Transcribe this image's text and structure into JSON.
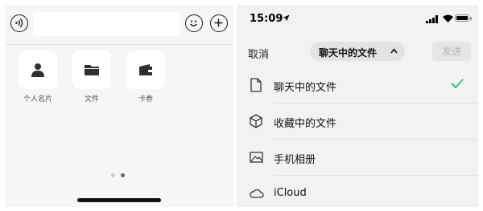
{
  "left_panel": {
    "input": {
      "value": ""
    },
    "tiles": [
      {
        "label": "个人名片",
        "icon": "contact-card-icon"
      },
      {
        "label": "文件",
        "icon": "folder-icon"
      },
      {
        "label": "卡券",
        "icon": "wallet-icon"
      }
    ],
    "page_indicator": {
      "pages": 2,
      "current": 2
    },
    "colors": {
      "tile_icon": "#2f2f2f",
      "dot_active": "#666666",
      "dot_inactive": "#cccccc"
    }
  },
  "right_panel": {
    "status_bar": {
      "time": "15:09",
      "location_icon": "location-arrow-icon"
    },
    "nav": {
      "cancel_label": "取消",
      "title": "聊天中的文件",
      "send_label": "发送"
    },
    "sources": [
      {
        "label": "聊天中的文件",
        "icon": "document-icon",
        "selected": true
      },
      {
        "label": "收藏中的文件",
        "icon": "cube-icon",
        "selected": false
      },
      {
        "label": "手机相册",
        "icon": "photo-icon",
        "selected": false
      },
      {
        "label": "iCloud",
        "icon": "cloud-icon",
        "selected": false
      }
    ],
    "colors": {
      "check": "#07c160",
      "send_disabled": "#b4b4b8"
    }
  }
}
